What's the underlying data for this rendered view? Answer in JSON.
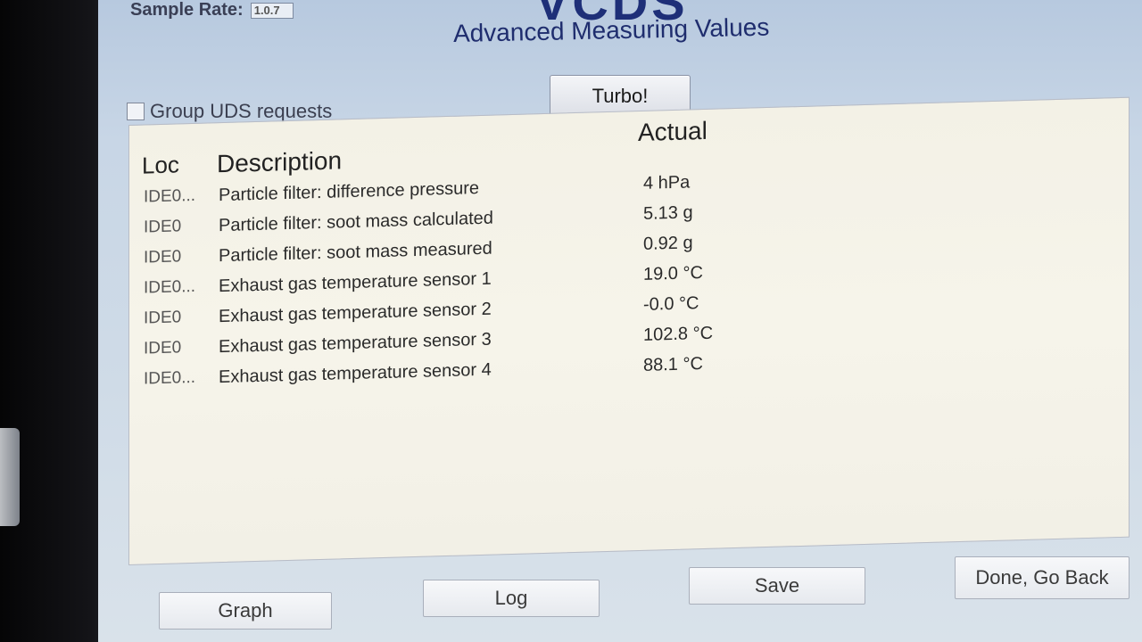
{
  "header": {
    "sample_rate_label": "Sample Rate:",
    "sample_rate_value": "1.0.7",
    "logo_text": "VCDS",
    "title": "Advanced Measuring Values"
  },
  "controls": {
    "turbo_label": "Turbo!",
    "group_uds_label": "Group UDS requests",
    "group_uds_checked": false
  },
  "table": {
    "columns": {
      "loc": "Loc",
      "description": "Description",
      "actual": "Actual"
    },
    "rows": [
      {
        "loc": "IDE0...",
        "description": "Particle filter: difference pressure",
        "actual": "4 hPa"
      },
      {
        "loc": "IDE0",
        "description": "Particle filter: soot mass calculated",
        "actual": "5.13 g"
      },
      {
        "loc": "IDE0",
        "description": "Particle filter: soot mass measured",
        "actual": "0.92 g"
      },
      {
        "loc": "IDE0...",
        "description": "Exhaust gas temperature sensor 1",
        "actual": "19.0 °C"
      },
      {
        "loc": "IDE0",
        "description": "Exhaust gas temperature sensor 2",
        "actual": "-0.0 °C"
      },
      {
        "loc": "IDE0",
        "description": "Exhaust gas temperature sensor 3",
        "actual": "102.8 °C"
      },
      {
        "loc": "IDE0...",
        "description": "Exhaust gas temperature sensor 4",
        "actual": "88.1 °C"
      }
    ]
  },
  "buttons": {
    "graph": "Graph",
    "log": "Log",
    "save": "Save",
    "done": "Done, Go Back"
  },
  "colors": {
    "title": "#1f2d6e",
    "panel": "#f4f2e8",
    "window": "#c8d6e6"
  }
}
